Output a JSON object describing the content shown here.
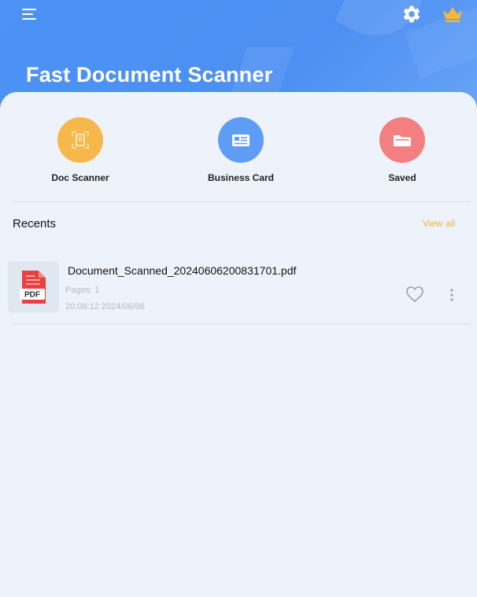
{
  "header": {
    "title": "Fast Document Scanner",
    "menu_icon": "hamburger-menu-icon",
    "settings_icon": "gear-icon",
    "premium_icon": "crown-icon"
  },
  "features": [
    {
      "label": "Doc Scanner",
      "icon": "scan-document-icon",
      "color": "#f7b84b"
    },
    {
      "label": "Business Card",
      "icon": "id-card-icon",
      "color": "#5f9cf5"
    },
    {
      "label": "Saved",
      "icon": "folder-icon",
      "color": "#f47f80"
    }
  ],
  "recents": {
    "title": "Recents",
    "view_all": "View all",
    "items": [
      {
        "name": "Document_Scanned_20240606200831701.pdf",
        "pages": "Pages: 1",
        "date": "20:08:12 2024/06/06",
        "thumb_label": "PDF",
        "thumb_icon": "pdf-file-icon",
        "favorite_icon": "heart-outline-icon",
        "more_icon": "more-vertical-icon"
      }
    ]
  },
  "colors": {
    "header_blue": "#4d8ff2",
    "accent_orange": "#f3b23e",
    "background": "#eef3fb"
  }
}
